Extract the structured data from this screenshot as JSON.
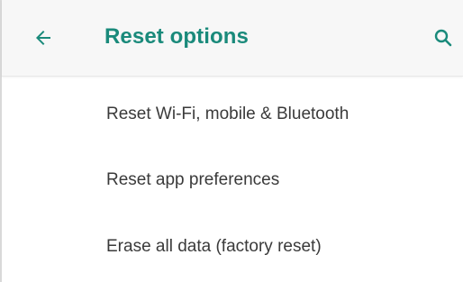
{
  "toolbar": {
    "back_icon": "arrow-left-icon",
    "title": "Reset options",
    "search_icon": "search-icon",
    "accent_color": "#1a8a7b"
  },
  "menu": {
    "items": [
      {
        "label": "Reset Wi-Fi, mobile & Bluetooth"
      },
      {
        "label": "Reset app preferences"
      },
      {
        "label": "Erase all data (factory reset)"
      }
    ]
  }
}
